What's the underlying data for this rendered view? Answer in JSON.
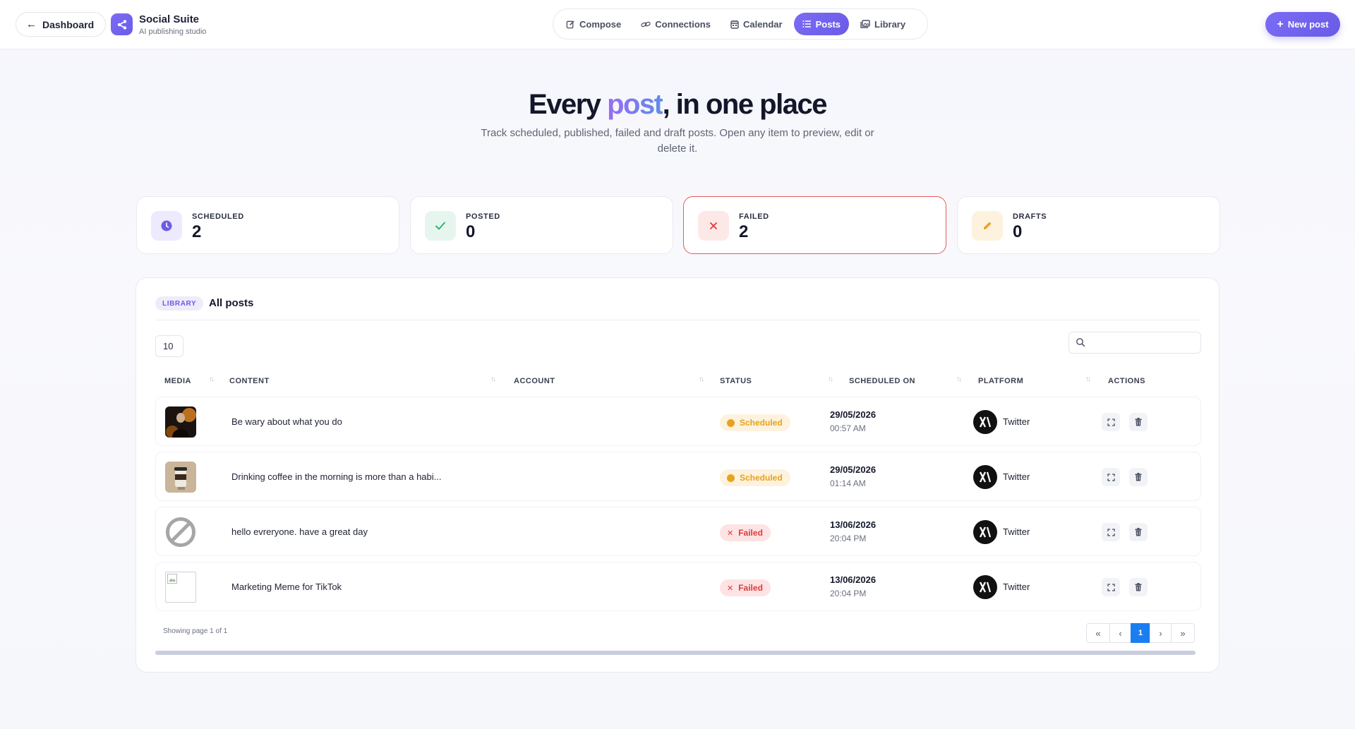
{
  "header": {
    "back_label": "Dashboard",
    "brand_title": "Social Suite",
    "brand_subtitle": "AI publishing studio",
    "new_post_label": "New post",
    "accent_color": "#6b5ce7"
  },
  "nav": [
    {
      "label": "Compose",
      "icon": "edit-icon",
      "active": false
    },
    {
      "label": "Connections",
      "icon": "link-icon",
      "active": false
    },
    {
      "label": "Calendar",
      "icon": "calendar-icon",
      "active": false
    },
    {
      "label": "Posts",
      "icon": "list-icon",
      "active": true
    },
    {
      "label": "Library",
      "icon": "gallery-icon",
      "active": false
    }
  ],
  "hero": {
    "title_pre": "Every ",
    "title_accent": "post",
    "title_post": ", in one place",
    "subtitle": "Track scheduled, published, failed and draft posts. Open any item to preview, edit or delete it."
  },
  "stats": [
    {
      "label": "SCHEDULED",
      "value": "2",
      "icon": "clock-icon",
      "color": "#6b5ce7"
    },
    {
      "label": "POSTED",
      "value": "0",
      "icon": "check-icon",
      "color": "#2bb673"
    },
    {
      "label": "FAILED",
      "value": "2",
      "icon": "x-icon",
      "color": "#e0393a"
    },
    {
      "label": "DRAFTS",
      "value": "0",
      "icon": "pencil-icon",
      "color": "#f0a21e"
    }
  ],
  "library": {
    "badge": "LIBRARY",
    "title": "All posts",
    "page_size": "10",
    "search_placeholder": "",
    "columns": [
      "MEDIA",
      "CONTENT",
      "ACCOUNT",
      "STATUS",
      "SCHEDULED ON",
      "PLATFORM",
      "ACTIONS"
    ],
    "rows": [
      {
        "media": "photo-person",
        "content": "Be wary about what you do",
        "account": "",
        "status": "Scheduled",
        "date": "29/05/2026",
        "time": "00:57 AM",
        "platform": "Twitter"
      },
      {
        "media": "photo-coffee",
        "content": "Drinking coffee in the morning is more than a habi...",
        "account": "",
        "status": "Scheduled",
        "date": "29/05/2026",
        "time": "01:14 AM",
        "platform": "Twitter"
      },
      {
        "media": "no-media",
        "content": "hello evreryone. have a great day",
        "account": "",
        "status": "Failed",
        "date": "13/06/2026",
        "time": "20:04 PM",
        "platform": "Twitter"
      },
      {
        "media": "broken-image",
        "content": "Marketing Meme for TikTok",
        "account": "",
        "status": "Failed",
        "date": "13/06/2026",
        "time": "20:04 PM",
        "platform": "Twitter"
      }
    ],
    "pagination": {
      "info": "Showing page 1 of 1",
      "first": "«",
      "prev": "‹",
      "current": "1",
      "next": "›",
      "last": "»"
    }
  }
}
